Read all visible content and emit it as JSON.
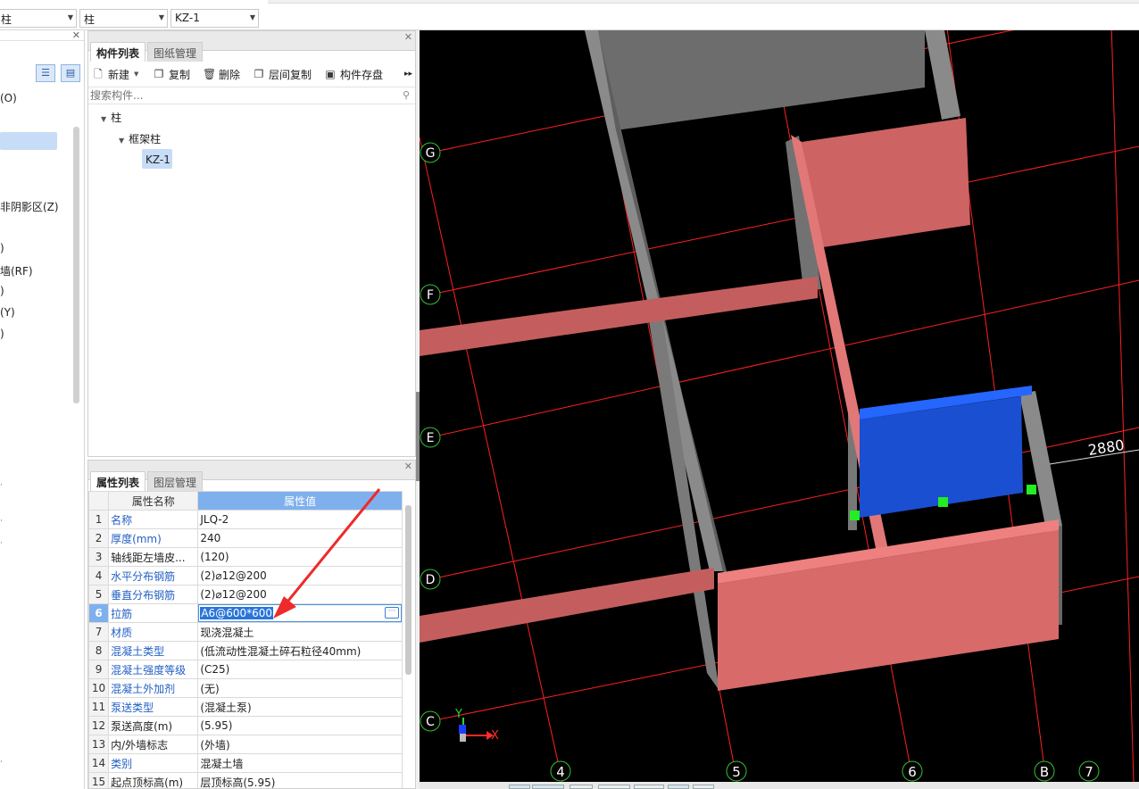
{
  "topbar": {
    "combo1": "柱",
    "combo2": "柱",
    "combo3": "KZ-1"
  },
  "leftnav": {
    "items": [
      "(O)",
      "非阴影区(Z)",
      ")",
      "墙(RF)",
      ")",
      "(Y)",
      ")"
    ]
  },
  "component_panel": {
    "tabs": [
      "构件列表",
      "图纸管理"
    ],
    "toolbar": {
      "new": "新建",
      "copy": "复制",
      "delete": "删除",
      "floor_copy": "层间复制",
      "save": "构件存盘"
    },
    "search_placeholder": "搜索构件...",
    "tree": {
      "root": "柱",
      "child": "框架柱",
      "leaf": "KZ-1"
    }
  },
  "property_panel": {
    "tabs": [
      "属性列表",
      "图层管理"
    ],
    "header": {
      "name": "属性名称",
      "value": "属性值"
    },
    "rows": [
      {
        "n": "1",
        "name": "名称",
        "value": "JLQ-2"
      },
      {
        "n": "2",
        "name": "厚度(mm)",
        "value": "240"
      },
      {
        "n": "3",
        "name": "轴线距左墙皮...",
        "value": "(120)"
      },
      {
        "n": "4",
        "name": "水平分布钢筋",
        "value": "(2)⌀12@200"
      },
      {
        "n": "5",
        "name": "垂直分布钢筋",
        "value": "(2)⌀12@200"
      },
      {
        "n": "6",
        "name": "拉筋",
        "value": "A6@600*600"
      },
      {
        "n": "7",
        "name": "材质",
        "value": "现浇混凝土"
      },
      {
        "n": "8",
        "name": "混凝土类型",
        "value": "(低流动性混凝土碎石粒径40mm)"
      },
      {
        "n": "9",
        "name": "混凝土强度等级",
        "value": "(C25)"
      },
      {
        "n": "10",
        "name": "混凝土外加剂",
        "value": "(无)"
      },
      {
        "n": "11",
        "name": "泵送类型",
        "value": "(混凝土泵)"
      },
      {
        "n": "12",
        "name": "泵送高度(m)",
        "value": "(5.95)"
      },
      {
        "n": "13",
        "name": "内/外墙标志",
        "value": "(外墙)"
      },
      {
        "n": "14",
        "name": "类别",
        "value": "混凝土墙"
      },
      {
        "n": "15",
        "name": "起点顶标高(m)",
        "value": "层顶标高(5.95)"
      }
    ]
  },
  "viewport": {
    "grid_rows": [
      "G",
      "F",
      "E",
      "D",
      "C"
    ],
    "grid_cols": [
      "4",
      "5",
      "6",
      "B",
      "7"
    ],
    "dimension": "2880",
    "axis_x": "X",
    "axis_y": "Y",
    "colors": {
      "background": "#000000",
      "grid": "#ff2020",
      "wall_gray": "#7a7a7a",
      "wall_pink": "#d06464",
      "wall_blue": "#1e5de6",
      "grip": "#22ee22"
    }
  },
  "annotation": {
    "arrow_color": "#ee2a2a"
  }
}
